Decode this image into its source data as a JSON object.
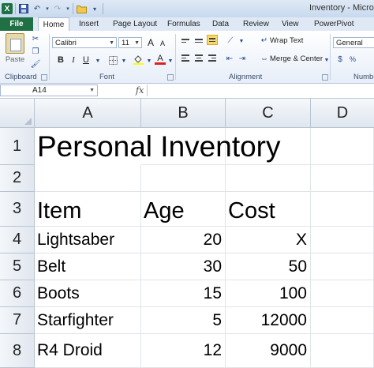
{
  "window": {
    "title": "Inventory - Microsc"
  },
  "quick_access": {
    "icons": [
      "excel-logo-icon",
      "save-icon",
      "undo-icon",
      "redo-icon",
      "open-folder-icon",
      "customize-icon"
    ]
  },
  "tabs": [
    "File",
    "Home",
    "Insert",
    "Page Layout",
    "Formulas",
    "Data",
    "Review",
    "View",
    "PowerPivot"
  ],
  "ribbon": {
    "clipboard": {
      "paste_label": "Paste",
      "group_label": "Clipboard"
    },
    "font": {
      "font_name": "Calibri",
      "font_size": "11",
      "bold": "B",
      "italic": "I",
      "underline": "U",
      "grow": "A",
      "shrink": "A",
      "font_color": "A",
      "group_label": "Font"
    },
    "alignment": {
      "wrap_text": "Wrap Text",
      "merge_center": "Merge & Center",
      "group_label": "Alignment"
    },
    "number": {
      "format": "General",
      "group_label": "Numbe"
    }
  },
  "formula_bar": {
    "name_box": "A14",
    "fx": "fx",
    "formula": ""
  },
  "columns": [
    "A",
    "B",
    "C",
    "D"
  ],
  "rows": [
    "1",
    "2",
    "3",
    "4",
    "5",
    "6",
    "7",
    "8"
  ],
  "sheet": {
    "title": "Personal Inventory",
    "headers": {
      "item": "Item",
      "age": "Age",
      "cost": "Cost"
    },
    "items": [
      {
        "item": "Lightsaber",
        "age": "20",
        "cost": "X"
      },
      {
        "item": "Belt",
        "age": "30",
        "cost": "50"
      },
      {
        "item": "Boots",
        "age": "15",
        "cost": "100"
      },
      {
        "item": "Starfighter",
        "age": "5",
        "cost": "12000"
      },
      {
        "item": "R4 Droid",
        "age": "12",
        "cost": "9000"
      }
    ]
  },
  "colors": {
    "file_tab": "#1f7044",
    "ribbon_bg": "#e7eef8",
    "highlight": "#f8d86a"
  }
}
